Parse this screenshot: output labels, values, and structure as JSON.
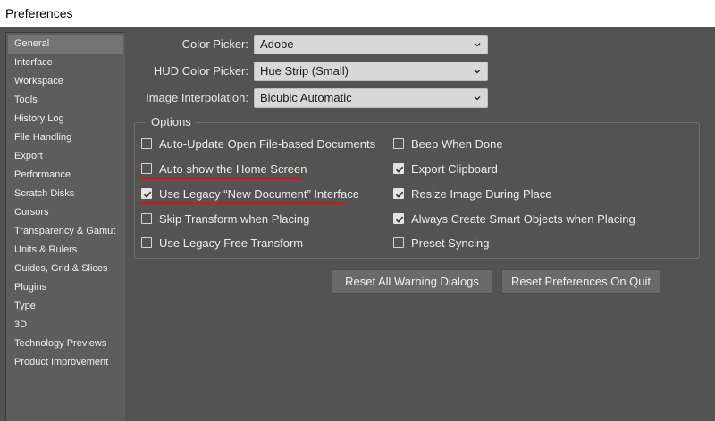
{
  "window": {
    "title": "Preferences"
  },
  "sidebar": {
    "items": [
      {
        "label": "General",
        "selected": true
      },
      {
        "label": "Interface"
      },
      {
        "label": "Workspace"
      },
      {
        "label": "Tools"
      },
      {
        "label": "History Log"
      },
      {
        "label": "File Handling"
      },
      {
        "label": "Export"
      },
      {
        "label": "Performance"
      },
      {
        "label": "Scratch Disks"
      },
      {
        "label": "Cursors"
      },
      {
        "label": "Transparency & Gamut"
      },
      {
        "label": "Units & Rulers"
      },
      {
        "label": "Guides, Grid & Slices"
      },
      {
        "label": "Plugins"
      },
      {
        "label": "Type"
      },
      {
        "label": "3D"
      },
      {
        "label": "Technology Previews"
      },
      {
        "label": "Product Improvement"
      }
    ]
  },
  "general": {
    "color_picker": {
      "label": "Color Picker:",
      "value": "Adobe"
    },
    "hud_color_picker": {
      "label": "HUD Color Picker:",
      "value": "Hue Strip (Small)"
    },
    "image_interpolation": {
      "label": "Image Interpolation:",
      "value": "Bicubic Automatic"
    }
  },
  "options": {
    "title": "Options",
    "left": [
      {
        "label": "Auto-Update Open File-based Documents",
        "checked": false
      },
      {
        "label": "Auto show the Home Screen",
        "checked": false
      },
      {
        "label": "Use Legacy “New Document” Interface",
        "checked": true
      },
      {
        "label": "Skip Transform when Placing",
        "checked": false
      },
      {
        "label": "Use Legacy Free Transform",
        "checked": false
      }
    ],
    "right": [
      {
        "label": "Beep When Done",
        "checked": false
      },
      {
        "label": "Export Clipboard",
        "checked": true
      },
      {
        "label": "Resize Image During Place",
        "checked": true
      },
      {
        "label": "Always Create Smart Objects when Placing",
        "checked": true
      },
      {
        "label": "Preset Syncing",
        "checked": false
      }
    ]
  },
  "buttons": {
    "reset_warning": "Reset All Warning Dialogs",
    "reset_prefs": "Reset Preferences On Quit"
  },
  "colors": {
    "annotation_underline": "#d7121a"
  }
}
